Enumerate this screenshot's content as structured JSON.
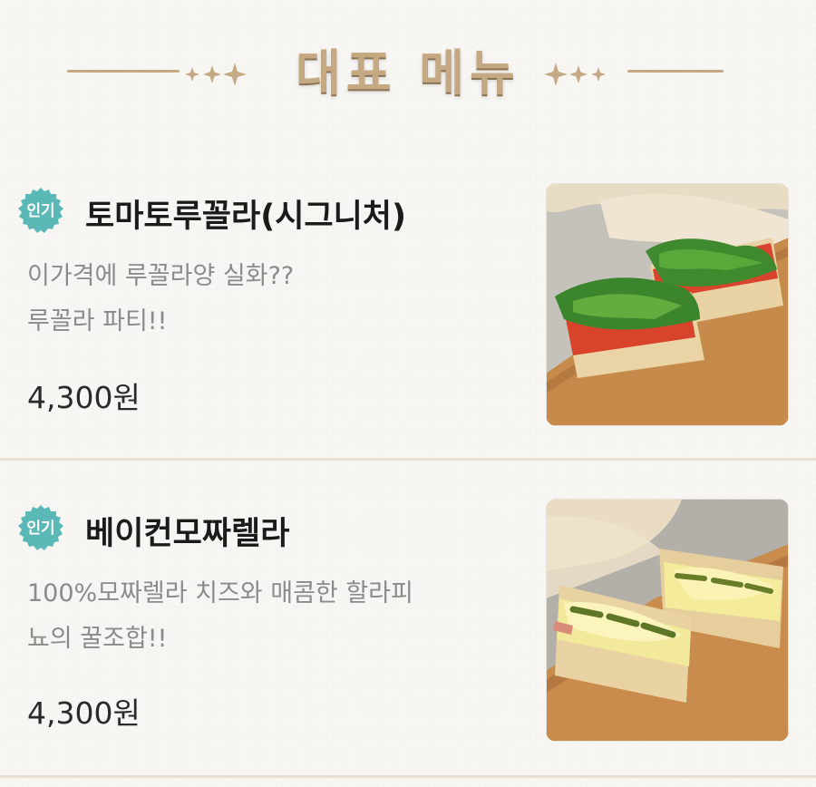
{
  "header": {
    "title": "대표 메뉴"
  },
  "menu_items": [
    {
      "badge": "인기",
      "name": "토마토루꼴라(시그니처)",
      "description_lines": [
        "이가격에 루꼴라양 실화??",
        "루꼴라 파티!!"
      ],
      "price": "4,300원"
    },
    {
      "badge": "인기",
      "name": "베이컨모짜렐라",
      "description_lines": [
        "100%모짜렐라 치즈와 매콤한 할라피",
        "뇨의 꿀조합!!"
      ],
      "price": "4,300원"
    }
  ],
  "colors": {
    "accent_gold": "#c4a982",
    "badge_teal": "#5ab9b6",
    "text_dark": "#1b1b1b",
    "text_muted": "#8b8b8b",
    "divider": "#e9e0d3"
  }
}
